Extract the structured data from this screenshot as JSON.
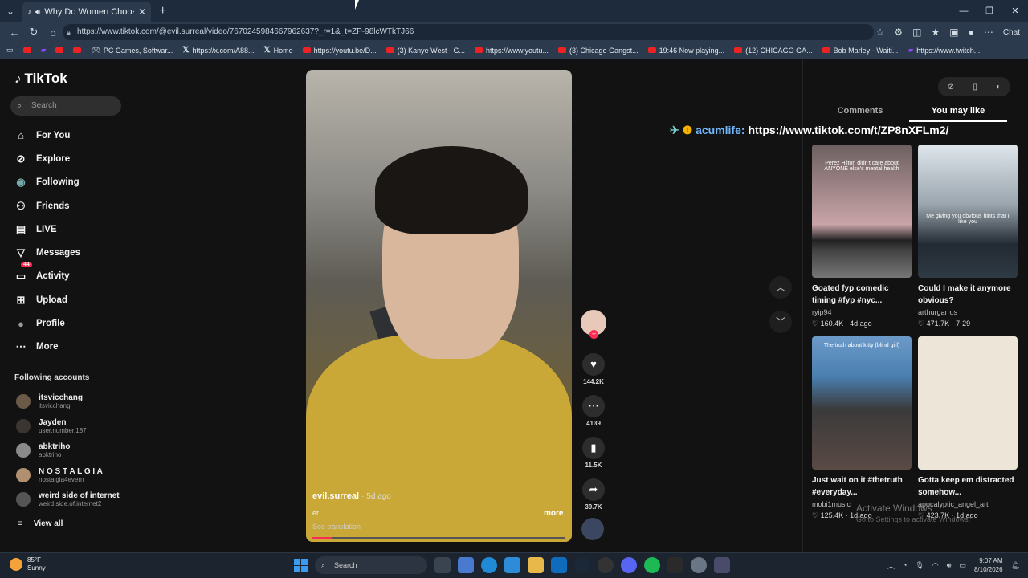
{
  "browser": {
    "tab_title": "Why Do Women Choose 'Do...",
    "url": "https://www.tiktok.com/@evil.surreal/video/7670245984667962637?_r=1&_t=ZP-98lcWTkTJ66",
    "chat_label": "Chat",
    "bookmarks": [
      "PC Games, Softwar...",
      "https://x.com/A88...",
      "Home",
      "https://youtu.be/D...",
      "(3) Kanye West - G...",
      "https://www.youtu...",
      "(3) Chicago Gangst...",
      "19:46 Now playing...",
      "(12) CHICAGO GA...",
      "Bob Marley - Waiti...",
      "https://www.twitch..."
    ]
  },
  "sidebar": {
    "logo": "TikTok",
    "search_placeholder": "Search",
    "items": [
      {
        "label": "For You"
      },
      {
        "label": "Explore"
      },
      {
        "label": "Following"
      },
      {
        "label": "Friends"
      },
      {
        "label": "LIVE"
      },
      {
        "label": "Messages"
      },
      {
        "label": "Activity",
        "badge": "44"
      },
      {
        "label": "Upload"
      },
      {
        "label": "Profile"
      },
      {
        "label": "More"
      }
    ],
    "following_title": "Following accounts",
    "following": [
      {
        "name": "itsvicchang",
        "handle": "itsvicchang"
      },
      {
        "name": "Jayden",
        "handle": "user.number.187"
      },
      {
        "name": "abktriho",
        "handle": "abktriho"
      },
      {
        "name": "N O S T A L G I A",
        "handle": "nostalgia4everrr"
      },
      {
        "name": "weird side of internet",
        "handle": "weird.side.of.internet2"
      }
    ],
    "view_all": "View all"
  },
  "video": {
    "username": "evil.surreal",
    "age": "· 5d ago",
    "caption": "er",
    "translation": "See translation",
    "more": "more",
    "progress": 0.08,
    "likes": "144.2K",
    "comments": "4139",
    "saves": "11.5K",
    "shares": "39.7K"
  },
  "right_panel": {
    "tabs": [
      "Comments",
      "You may like"
    ],
    "overlay_user": "acumlife:",
    "overlay_link": "https://www.tiktok.com/t/ZP8nXFLm2/",
    "cards": [
      {
        "title": "Goated fyp comedic timing #fyp #nyc...",
        "author": "ryip94",
        "likes": "160.4K",
        "date": "4d ago",
        "thumb_text": "Perez Hilton didn't care about ANYONE else's mental health"
      },
      {
        "title": "Could I make it anymore obvious?",
        "author": "arthurgarros",
        "likes": "471.7K",
        "date": "7-29",
        "thumb_text": "Me giving you obvious hints that I like you"
      },
      {
        "title": "Just wait on it #thetruth #everyday...",
        "author": "mobi1music",
        "likes": "125.4K",
        "date": "1d ago",
        "thumb_text": "The truth about kitty (blind girl)"
      },
      {
        "title": "Gotta keep em distracted somehow...",
        "author": "apocalyptic_angel_art",
        "likes": "423.7K",
        "date": "1d ago",
        "thumb_text": ""
      }
    ],
    "watermark": "Activate Windows",
    "watermark_sub": "Go to Settings to activate Windows."
  },
  "taskbar": {
    "temp": "85°F",
    "weather": "Sunny",
    "search": "Search",
    "time": "9:07 AM",
    "date": "8/10/2026"
  }
}
